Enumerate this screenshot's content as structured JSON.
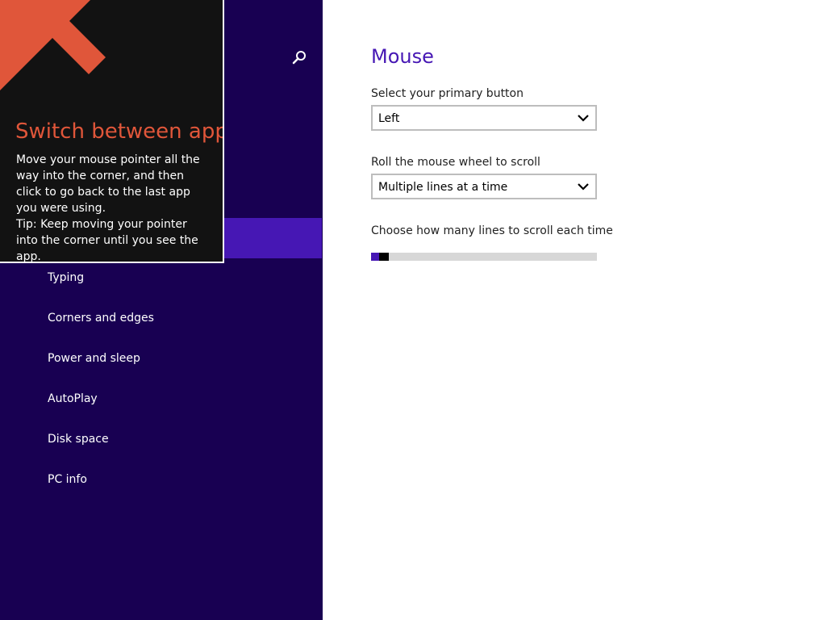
{
  "nav": {
    "items": [
      {
        "label": "Typing"
      },
      {
        "label": "Corners and edges"
      },
      {
        "label": "Power and sleep"
      },
      {
        "label": "AutoPlay"
      },
      {
        "label": "Disk space"
      },
      {
        "label": "PC info"
      }
    ],
    "icons": {
      "search": "search-icon"
    }
  },
  "tip": {
    "title": "Switch between apps",
    "body": "Move your mouse pointer all the way into the corner, and then click to go back to the last app you were using.",
    "tip_line": "Tip: Keep moving your pointer into the corner until you see the app.",
    "arrow_icon": "arrow-up-left-icon"
  },
  "main": {
    "title": "Mouse",
    "primary_button": {
      "label": "Select your primary button",
      "value": "Left"
    },
    "wheel": {
      "label": "Roll the mouse wheel to scroll",
      "value": "Multiple lines at a time"
    },
    "lines": {
      "label": "Choose how many lines to scroll each time",
      "fraction": 0.02
    }
  },
  "colors": {
    "nav_background": "#180052",
    "accent": "#4617b4",
    "tip_title": "#e0563a",
    "tip_background": "#121212"
  }
}
